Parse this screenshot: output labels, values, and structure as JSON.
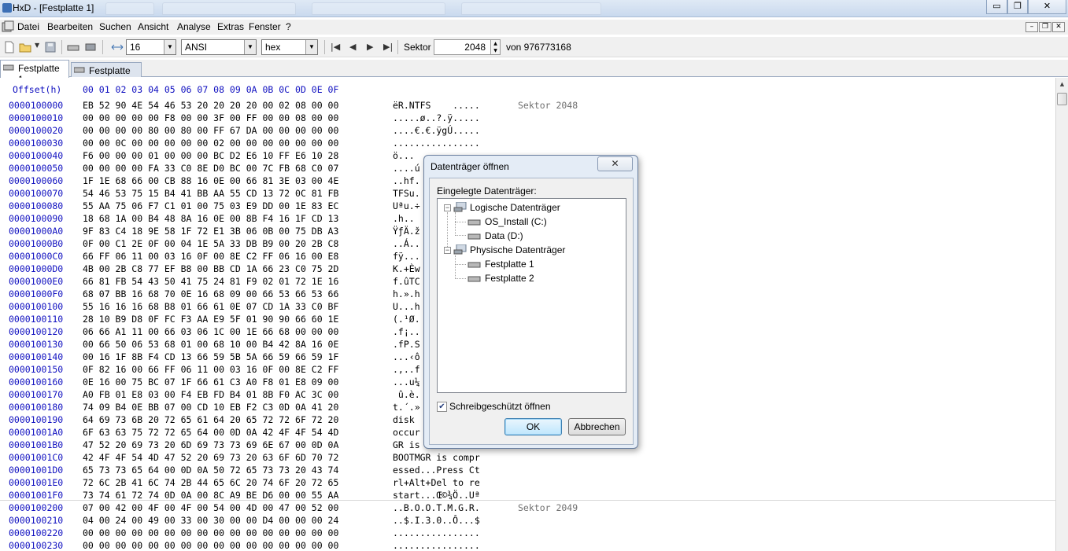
{
  "window": {
    "title": "HxD - [Festplatte 1]",
    "controls": {
      "minimize": "▭",
      "maximize": "❐",
      "close": "✕"
    }
  },
  "menu": {
    "items": [
      "Datei",
      "Bearbeiten",
      "Suchen",
      "Ansicht",
      "Analyse",
      "Extras",
      "Fenster",
      "?"
    ],
    "mdi_controls": {
      "minimize": "–",
      "restore": "❐",
      "close": "✕"
    }
  },
  "toolbar": {
    "bytes_per_row": "16",
    "charset": "ANSI",
    "offset_base": "hex",
    "sector_label": "Sektor",
    "sector_value": "2048",
    "of_total": "von 976773168",
    "icons": [
      "new-file-icon",
      "open-file-icon",
      "save-icon",
      "open-disk-icon",
      "open-ram-icon",
      "bytes-per-row-icon"
    ]
  },
  "tabs": [
    {
      "label": "Festplatte 1",
      "active": true
    },
    {
      "label": "Festplatte 2",
      "active": false
    }
  ],
  "hex": {
    "header_offset": "Offset(h)",
    "header_columns": "00 01 02 03 04 05 06 07 08 09 0A 0B 0C 0D 0E 0F",
    "rows": [
      {
        "offset": "0000100000",
        "hex": "EB 52 90 4E 54 46 53 20 20 20 20 00 02 08 00 00",
        "text": "ëR.NTFS    .....",
        "sector": "Sektor 2048"
      },
      {
        "offset": "0000100010",
        "hex": "00 00 00 00 00 F8 00 00 3F 00 FF 00 00 08 00 00",
        "text": ".....ø..?.ÿ....."
      },
      {
        "offset": "0000100020",
        "hex": "00 00 00 00 80 00 80 00 FF 67 DA 00 00 00 00 00",
        "text": "....€.€.ÿgÚ....."
      },
      {
        "offset": "0000100030",
        "hex": "00 00 0C 00 00 00 00 00 02 00 00 00 00 00 00 00",
        "text": "................"
      },
      {
        "offset": "0000100040",
        "hex": "F6 00 00 00 01 00 00 00 BC D2 E6 10 FF E6 10 28",
        "text": "ö..."
      },
      {
        "offset": "0000100050",
        "hex": "00 00 00 00 FA 33 C0 8E D0 BC 00 7C FB 68 C0 07",
        "text": "....ú"
      },
      {
        "offset": "0000100060",
        "hex": "1F 1E 68 66 00 CB 88 16 0E 00 66 81 3E 03 00 4E",
        "text": "..hf."
      },
      {
        "offset": "0000100070",
        "hex": "54 46 53 75 15 B4 41 BB AA 55 CD 13 72 0C 81 FB",
        "text": "TFSu."
      },
      {
        "offset": "0000100080",
        "hex": "55 AA 75 06 F7 C1 01 00 75 03 E9 DD 00 1E 83 EC",
        "text": "Uªu.÷"
      },
      {
        "offset": "0000100090",
        "hex": "18 68 1A 00 B4 48 8A 16 0E 00 8B F4 16 1F CD 13",
        "text": ".h.."
      },
      {
        "offset": "00001000A0",
        "hex": "9F 83 C4 18 9E 58 1F 72 E1 3B 06 0B 00 75 DB A3",
        "text": "ŸƒÄ.ž"
      },
      {
        "offset": "00001000B0",
        "hex": "0F 00 C1 2E 0F 00 04 1E 5A 33 DB B9 00 20 2B C8",
        "text": "..Á.."
      },
      {
        "offset": "00001000C0",
        "hex": "66 FF 06 11 00 03 16 0F 00 8E C2 FF 06 16 00 E8",
        "text": "fÿ..."
      },
      {
        "offset": "00001000D0",
        "hex": "4B 00 2B C8 77 EF B8 00 BB CD 1A 66 23 C0 75 2D",
        "text": "K.+Èw"
      },
      {
        "offset": "00001000E0",
        "hex": "66 81 FB 54 43 50 41 75 24 81 F9 02 01 72 1E 16",
        "text": "f.ûTC"
      },
      {
        "offset": "00001000F0",
        "hex": "68 07 BB 16 68 70 0E 16 68 09 00 66 53 66 53 66",
        "text": "h.».h"
      },
      {
        "offset": "0000100100",
        "hex": "55 16 16 16 68 B8 01 66 61 0E 07 CD 1A 33 C0 BF",
        "text": "U...h"
      },
      {
        "offset": "0000100110",
        "hex": "28 10 B9 D8 0F FC F3 AA E9 5F 01 90 90 66 60 1E",
        "text": "(.¹Ø."
      },
      {
        "offset": "0000100120",
        "hex": "06 66 A1 11 00 66 03 06 1C 00 1E 66 68 00 00 00",
        "text": ".f¡.."
      },
      {
        "offset": "0000100130",
        "hex": "00 66 50 06 53 68 01 00 68 10 00 B4 42 8A 16 0E",
        "text": ".fP.S"
      },
      {
        "offset": "0000100140",
        "hex": "00 16 1F 8B F4 CD 13 66 59 5B 5A 66 59 66 59 1F",
        "text": "...‹ô"
      },
      {
        "offset": "0000100150",
        "hex": "0F 82 16 00 66 FF 06 11 00 03 16 0F 00 8E C2 FF",
        "text": ".‚..f"
      },
      {
        "offset": "0000100160",
        "hex": "0E 16 00 75 BC 07 1F 66 61 C3 A0 F8 01 E8 09 00",
        "text": "...u¼"
      },
      {
        "offset": "0000100170",
        "hex": "A0 FB 01 E8 03 00 F4 EB FD B4 01 8B F0 AC 3C 00",
        "text": " û.è."
      },
      {
        "offset": "0000100180",
        "hex": "74 09 B4 0E BB 07 00 CD 10 EB F2 C3 0D 0A 41 20",
        "text": "t.´.»"
      },
      {
        "offset": "0000100190",
        "hex": "64 69 73 6B 20 72 65 61 64 20 65 72 72 6F 72 20",
        "text": "disk "
      },
      {
        "offset": "00001001A0",
        "hex": "6F 63 63 75 72 72 65 64 00 0D 0A 42 4F 4F 54 4D",
        "text": "occur"
      },
      {
        "offset": "00001001B0",
        "hex": "47 52 20 69 73 20 6D 69 73 73 69 6E 67 00 0D 0A",
        "text": "GR is"
      },
      {
        "offset": "00001001C0",
        "hex": "42 4F 4F 54 4D 47 52 20 69 73 20 63 6F 6D 70 72",
        "text": "BOOTMGR is compr"
      },
      {
        "offset": "00001001D0",
        "hex": "65 73 73 65 64 00 0D 0A 50 72 65 73 73 20 43 74",
        "text": "essed...Press Ct"
      },
      {
        "offset": "00001001E0",
        "hex": "72 6C 2B 41 6C 74 2B 44 65 6C 20 74 6F 20 72 65",
        "text": "rl+Alt+Del to re"
      },
      {
        "offset": "00001001F0",
        "hex": "73 74 61 72 74 0D 0A 00 8C A9 BE D6 00 00 55 AA",
        "text": "start...Œ©¾Ö..Uª"
      },
      {
        "offset": "0000100200",
        "hex": "07 00 42 00 4F 00 4F 00 54 00 4D 00 47 00 52 00",
        "text": "..B.O.O.T.M.G.R.",
        "sector": "Sektor 2049"
      },
      {
        "offset": "0000100210",
        "hex": "04 00 24 00 49 00 33 00 30 00 00 D4 00 00 00 24",
        "text": "..$.I.3.0..Ô...$"
      },
      {
        "offset": "0000100220",
        "hex": "00 00 00 00 00 00 00 00 00 00 00 00 00 00 00 00",
        "text": "................"
      },
      {
        "offset": "0000100230",
        "hex": "00 00 00 00 00 00 00 00 00 00 00 00 00 00 00 00",
        "text": "................"
      }
    ]
  },
  "dialog": {
    "title": "Datenträger öffnen",
    "close": "✕",
    "group_label": "Eingelegte Datenträger:",
    "tree": {
      "logical": "Logische Datenträger",
      "logical_items": [
        "OS_Install (C:)",
        "Data (D:)"
      ],
      "physical": "Physische Datenträger",
      "physical_items": [
        "Festplatte 1",
        "Festplatte 2"
      ],
      "collapse_glyph": "−"
    },
    "readonly_label": "Schreibgeschützt öffnen",
    "readonly_checked": "✔",
    "ok": "OK",
    "cancel": "Abbrechen"
  },
  "colors": {
    "offset": "#1010c0",
    "sector_label": "#707070",
    "dialog_bg": "#e4ecf6"
  }
}
